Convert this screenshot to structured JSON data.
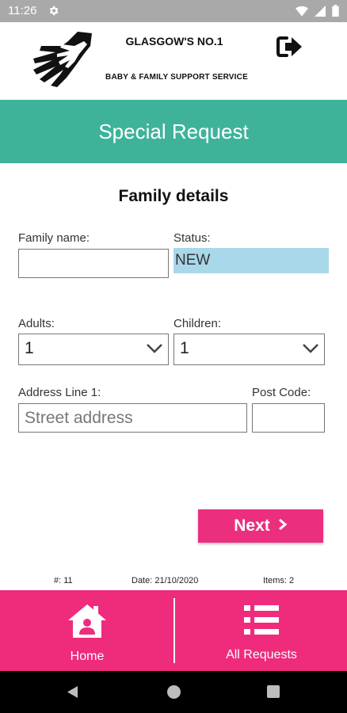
{
  "status_bar": {
    "time": "11:26"
  },
  "header": {
    "org_title": "GLASGOW'S NO.1",
    "org_subtitle": "BABY & FAMILY SUPPORT SERVICE"
  },
  "banner": {
    "title": "Special Request"
  },
  "form": {
    "section_title": "Family details",
    "family_name": {
      "label": "Family name:",
      "value": ""
    },
    "status": {
      "label": "Status:",
      "value": "NEW"
    },
    "adults": {
      "label": "Adults:",
      "value": "1"
    },
    "children": {
      "label": "Children:",
      "value": "1"
    },
    "address": {
      "label": "Address Line 1:",
      "placeholder": "Street address",
      "value": ""
    },
    "postcode": {
      "label": "Post Code:",
      "value": ""
    },
    "next_label": "Next"
  },
  "footer": {
    "request_number": "#: 11",
    "date": "Date: 21/10/2020",
    "items": "Items: 2"
  },
  "bottom_nav": {
    "home_label": "Home",
    "all_requests_label": "All Requests"
  },
  "colors": {
    "banner": "#3eb39a",
    "accent": "#ec2e7f",
    "status_highlight": "#a8d8e9"
  }
}
